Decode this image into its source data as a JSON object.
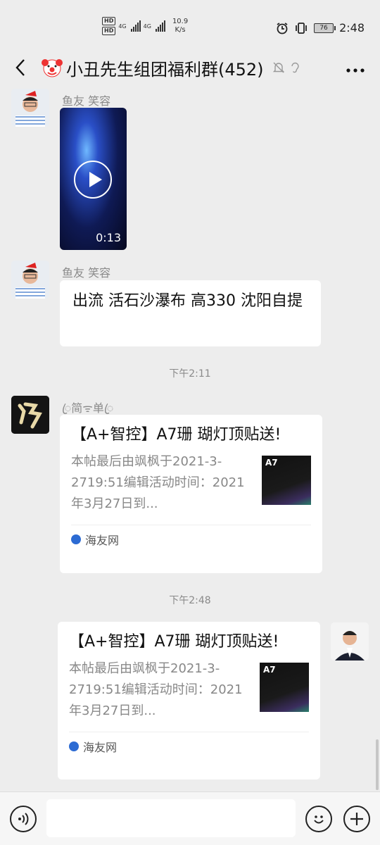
{
  "status": {
    "net1": "4G",
    "net2": "4G",
    "speed_value": "10.9",
    "speed_unit": "K/s",
    "battery": "76",
    "time": "2:48"
  },
  "header": {
    "title": "小丑先生组团福利群(452)"
  },
  "messages": {
    "m1": {
      "nick": "鱼友 笑容",
      "video_duration": "0:13"
    },
    "m2": {
      "nick": "鱼友 笑容",
      "text": "出流 活石沙瀑布 高330 沈阳自提"
    },
    "t1": "下午2:11",
    "m3": {
      "nick": "ꦿ简ᯤ单ꦿ",
      "title": "【A+智控】A7珊 瑚灯顶贴送!",
      "desc": "本帖最后由飒枫于2021-3-2719:51编辑活动时间：2021年3月27日到...",
      "thumb": "A7",
      "source": "海友网"
    },
    "t2": "下午2:48",
    "m4": {
      "title": "【A+智控】A7珊 瑚灯顶贴送!",
      "desc": "本帖最后由飒枫于2021-3-2719:51编辑活动时间：2021年3月27日到...",
      "thumb": "A7",
      "source": "海友网"
    }
  }
}
